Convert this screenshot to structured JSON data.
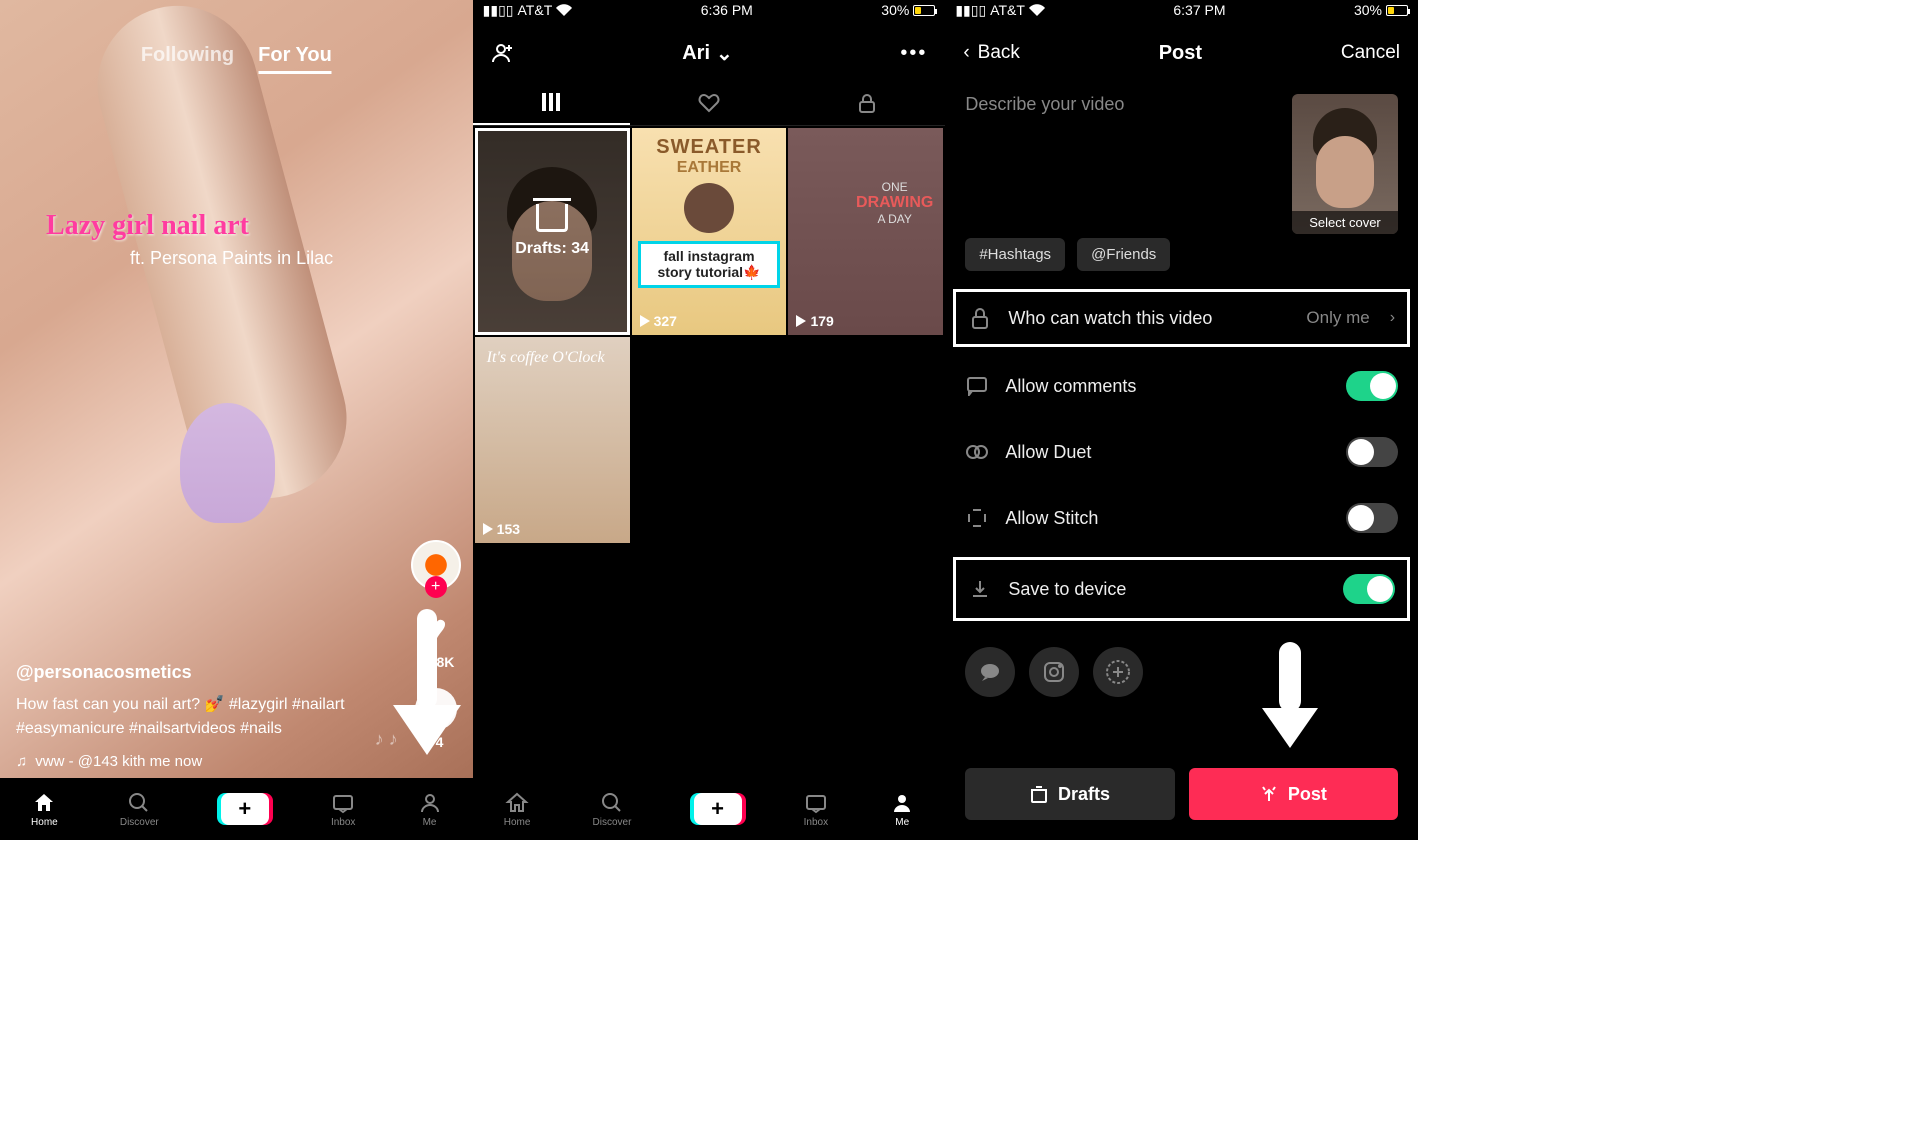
{
  "status": {
    "carrier": "AT&T",
    "time2": "6:36 PM",
    "time3": "6:37 PM",
    "battery": "30%"
  },
  "feed": {
    "tabs": {
      "following": "Following",
      "foryou": "For You"
    },
    "video_title": "Lazy girl nail art",
    "video_subtitle": "ft. Persona Paints in Lilac",
    "likes": "19.8K",
    "comments": "74",
    "username": "@personacosmetics",
    "caption": "How fast can you nail art? 💅 #lazygirl #nailart #easymanicure #nailsartvideos #nails",
    "music": "vww - @143   kith me now"
  },
  "nav": {
    "home": "Home",
    "discover": "Discover",
    "inbox": "Inbox",
    "me": "Me"
  },
  "profile": {
    "name": "Ari",
    "drafts_label": "Drafts: 34",
    "sweater_title": "SWEATER",
    "sweater_sub": "EATHER",
    "story_text": "fall instagram story tutorial🍁",
    "drawing_one": "ONE",
    "drawing_draw": "DRAWING",
    "drawing_day": "A DAY",
    "coffee_text": "It's coffee O'Clock",
    "views1": "327",
    "views2": "179",
    "views3": "153"
  },
  "post": {
    "back": "Back",
    "title": "Post",
    "cancel": "Cancel",
    "describe_placeholder": "Describe your video",
    "select_cover": "Select cover",
    "hashtags": "#Hashtags",
    "friends": "@Friends",
    "privacy_label": "Who can watch this video",
    "privacy_value": "Only me",
    "comments_label": "Allow comments",
    "duet_label": "Allow Duet",
    "stitch_label": "Allow Stitch",
    "save_label": "Save to device",
    "drafts_btn": "Drafts",
    "post_btn": "Post"
  }
}
